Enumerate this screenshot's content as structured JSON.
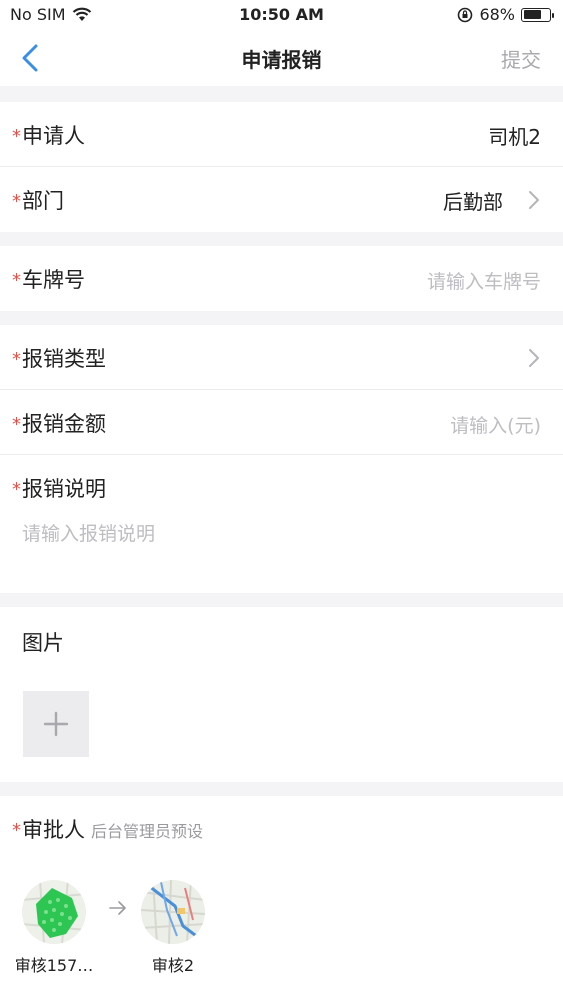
{
  "status_bar": {
    "carrier": "No SIM",
    "time": "10:50 AM",
    "battery": "68%",
    "battery_level": 0.68
  },
  "nav": {
    "title": "申请报销",
    "submit_label": "提交"
  },
  "form": {
    "applicant": {
      "label": "申请人",
      "value": "司机2"
    },
    "department": {
      "label": "部门",
      "value": "后勤部"
    },
    "plate": {
      "label": "车牌号",
      "placeholder": "请输入车牌号"
    },
    "type": {
      "label": "报销类型"
    },
    "amount": {
      "label": "报销金额",
      "placeholder": "请输入(元)"
    },
    "description": {
      "label": "报销说明",
      "placeholder": "请输入报销说明"
    }
  },
  "images": {
    "title": "图片",
    "add_icon": "plus-icon"
  },
  "approvers": {
    "label": "审批人",
    "hint": "后台管理员预设",
    "list": [
      {
        "name": "审核157…",
        "avatar_color": "#2dc653"
      },
      {
        "name": "审核2",
        "avatar_color": "#4a90d9"
      }
    ]
  },
  "colors": {
    "required_star": "#e8504a",
    "placeholder": "#bdbdc2",
    "accent": "#3a8ee6"
  }
}
